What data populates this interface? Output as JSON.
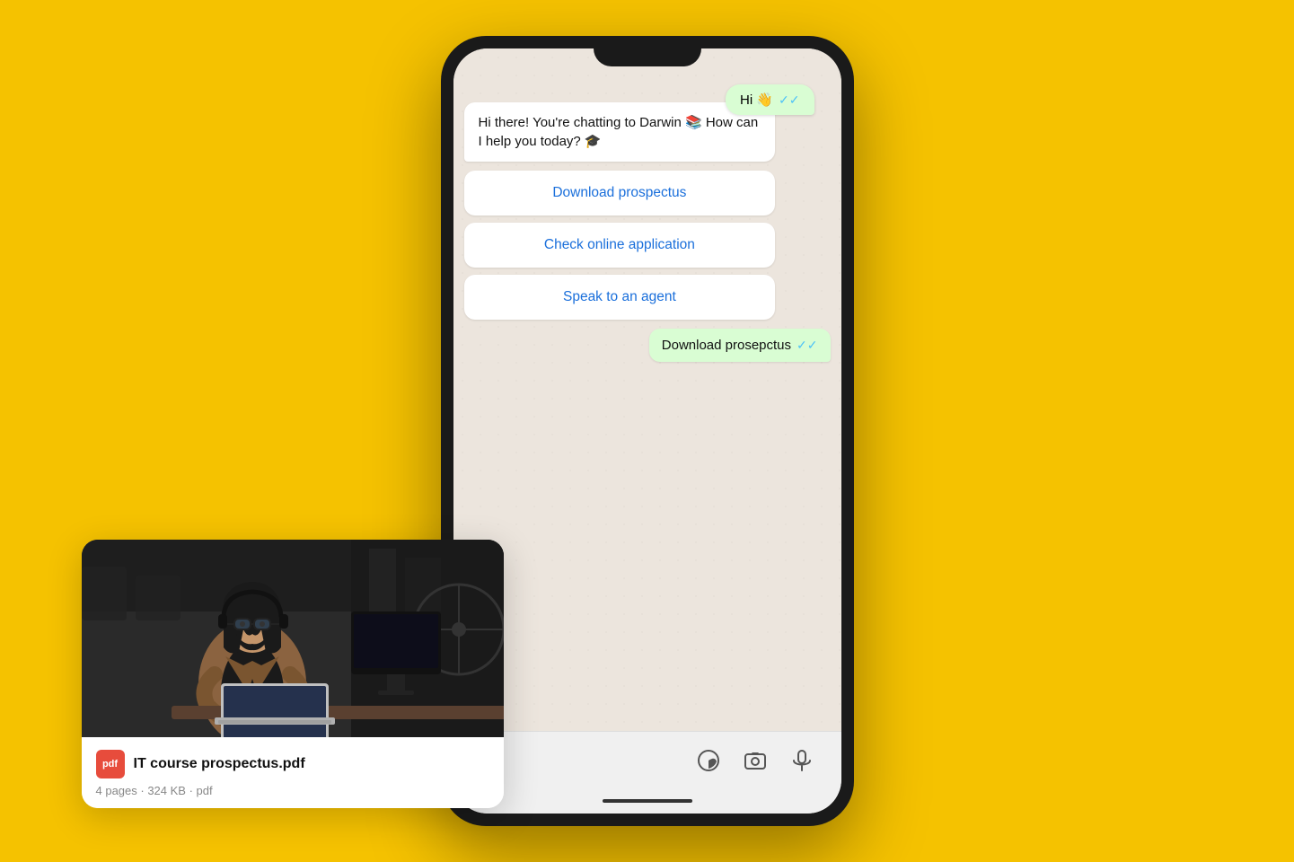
{
  "background_color": "#F5C200",
  "phone": {
    "greeting_bubble": {
      "text": "Hi 👋",
      "double_check": "✓✓"
    },
    "incoming_message": {
      "text": "Hi there! You're chatting to Darwin 📚 How can I help you today? 🎓"
    },
    "quick_replies": [
      {
        "label": "Download prospectus"
      },
      {
        "label": "Check online application"
      },
      {
        "label": "Speak to an agent"
      }
    ],
    "outgoing_message": {
      "text": "Download prosepctus",
      "double_check": "✓✓"
    },
    "bottom_bar": {
      "sticker_icon": "🩹",
      "camera_icon": "📷",
      "mic_icon": "🎤"
    }
  },
  "pdf_card": {
    "filename": "IT course prospectus.pdf",
    "meta": "4 pages · 324 KB · pdf",
    "pdf_label": "pdf"
  }
}
